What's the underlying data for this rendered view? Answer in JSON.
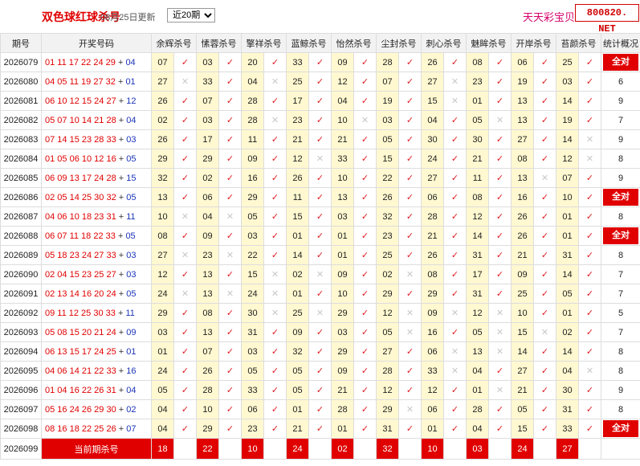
{
  "header": {
    "title": "双色球红球杀号",
    "date": "08月25日更新",
    "period_select": "近20期",
    "brand_name": "天天彩宝贝",
    "brand_domain": "800820. NET"
  },
  "columns": [
    "期号",
    "开奖号码",
    "余辉杀号",
    "愫蓉杀号",
    "擎祥杀号",
    "蓝鲸杀号",
    "怡然杀号",
    "尘封杀号",
    "刺心杀号",
    "魅眸杀号",
    "开岸杀号",
    "苔颜杀号",
    "统计概况"
  ],
  "rows": [
    {
      "issue": "2026079",
      "reds": "01 11 17 22 24 29",
      "blue": "04",
      "kills": [
        [
          "07",
          true
        ],
        [
          "03",
          true
        ],
        [
          "20",
          true
        ],
        [
          "33",
          true
        ],
        [
          "09",
          true
        ],
        [
          "28",
          true
        ],
        [
          "26",
          true
        ],
        [
          "08",
          true
        ],
        [
          "06",
          true
        ],
        [
          "25",
          true
        ]
      ],
      "stat": "全对"
    },
    {
      "issue": "2026080",
      "reds": "04 05 11 19 27 32",
      "blue": "01",
      "kills": [
        [
          "27",
          false
        ],
        [
          "33",
          true
        ],
        [
          "04",
          false
        ],
        [
          "25",
          true
        ],
        [
          "12",
          true
        ],
        [
          "07",
          true
        ],
        [
          "27",
          false
        ],
        [
          "23",
          true
        ],
        [
          "19",
          true
        ],
        [
          "03",
          true
        ]
      ],
      "stat": "6"
    },
    {
      "issue": "2026081",
      "reds": "06 10 12 15 24 27",
      "blue": "12",
      "kills": [
        [
          "26",
          true
        ],
        [
          "07",
          true
        ],
        [
          "28",
          true
        ],
        [
          "17",
          true
        ],
        [
          "04",
          true
        ],
        [
          "19",
          true
        ],
        [
          "15",
          false
        ],
        [
          "01",
          true
        ],
        [
          "13",
          true
        ],
        [
          "14",
          true
        ]
      ],
      "stat": "9"
    },
    {
      "issue": "2026082",
      "reds": "05 07 10 14 21 28",
      "blue": "04",
      "kills": [
        [
          "02",
          true
        ],
        [
          "03",
          true
        ],
        [
          "28",
          false
        ],
        [
          "23",
          true
        ],
        [
          "10",
          false
        ],
        [
          "03",
          true
        ],
        [
          "04",
          true
        ],
        [
          "05",
          false
        ],
        [
          "13",
          true
        ],
        [
          "19",
          true
        ]
      ],
      "stat": "7"
    },
    {
      "issue": "2026083",
      "reds": "07 14 15 23 28 33",
      "blue": "03",
      "kills": [
        [
          "26",
          true
        ],
        [
          "17",
          true
        ],
        [
          "11",
          true
        ],
        [
          "21",
          true
        ],
        [
          "21",
          true
        ],
        [
          "05",
          true
        ],
        [
          "30",
          true
        ],
        [
          "30",
          true
        ],
        [
          "27",
          true
        ],
        [
          "14",
          false
        ]
      ],
      "stat": "9"
    },
    {
      "issue": "2026084",
      "reds": "01 05 06 10 12 16",
      "blue": "05",
      "kills": [
        [
          "29",
          true
        ],
        [
          "29",
          true
        ],
        [
          "09",
          true
        ],
        [
          "12",
          false
        ],
        [
          "33",
          true
        ],
        [
          "15",
          true
        ],
        [
          "24",
          true
        ],
        [
          "21",
          true
        ],
        [
          "08",
          true
        ],
        [
          "12",
          false
        ]
      ],
      "stat": "8"
    },
    {
      "issue": "2026085",
      "reds": "06 09 13 17 24 28",
      "blue": "15",
      "kills": [
        [
          "32",
          true
        ],
        [
          "02",
          true
        ],
        [
          "16",
          true
        ],
        [
          "26",
          true
        ],
        [
          "10",
          true
        ],
        [
          "22",
          true
        ],
        [
          "27",
          true
        ],
        [
          "11",
          true
        ],
        [
          "13",
          false
        ],
        [
          "07",
          true
        ]
      ],
      "stat": "9"
    },
    {
      "issue": "2026086",
      "reds": "02 05 14 25 30 32",
      "blue": "05",
      "kills": [
        [
          "13",
          true
        ],
        [
          "06",
          true
        ],
        [
          "29",
          true
        ],
        [
          "11",
          true
        ],
        [
          "13",
          true
        ],
        [
          "26",
          true
        ],
        [
          "06",
          true
        ],
        [
          "08",
          true
        ],
        [
          "16",
          true
        ],
        [
          "10",
          true
        ]
      ],
      "stat": "全对"
    },
    {
      "issue": "2026087",
      "reds": "04 06 10 18 23 31",
      "blue": "11",
      "kills": [
        [
          "10",
          false
        ],
        [
          "04",
          false
        ],
        [
          "05",
          true
        ],
        [
          "15",
          true
        ],
        [
          "03",
          true
        ],
        [
          "32",
          true
        ],
        [
          "28",
          true
        ],
        [
          "12",
          true
        ],
        [
          "26",
          true
        ],
        [
          "01",
          true
        ]
      ],
      "stat": "8"
    },
    {
      "issue": "2026088",
      "reds": "06 07 11 18 22 33",
      "blue": "05",
      "kills": [
        [
          "08",
          true
        ],
        [
          "09",
          true
        ],
        [
          "03",
          true
        ],
        [
          "01",
          true
        ],
        [
          "01",
          true
        ],
        [
          "23",
          true
        ],
        [
          "21",
          true
        ],
        [
          "14",
          true
        ],
        [
          "26",
          true
        ],
        [
          "01",
          true
        ]
      ],
      "stat": "全对"
    },
    {
      "issue": "2026089",
      "reds": "05 18 23 24 27 33",
      "blue": "03",
      "kills": [
        [
          "27",
          false
        ],
        [
          "23",
          false
        ],
        [
          "22",
          true
        ],
        [
          "14",
          true
        ],
        [
          "01",
          true
        ],
        [
          "25",
          true
        ],
        [
          "26",
          true
        ],
        [
          "31",
          true
        ],
        [
          "21",
          true
        ],
        [
          "31",
          true
        ]
      ],
      "stat": "8"
    },
    {
      "issue": "2026090",
      "reds": "02 04 15 23 25 27",
      "blue": "03",
      "kills": [
        [
          "12",
          true
        ],
        [
          "13",
          true
        ],
        [
          "15",
          false
        ],
        [
          "02",
          false
        ],
        [
          "09",
          true
        ],
        [
          "02",
          false
        ],
        [
          "08",
          true
        ],
        [
          "17",
          true
        ],
        [
          "09",
          true
        ],
        [
          "14",
          true
        ]
      ],
      "stat": "7"
    },
    {
      "issue": "2026091",
      "reds": "02 13 14 16 20 24",
      "blue": "05",
      "kills": [
        [
          "24",
          false
        ],
        [
          "13",
          false
        ],
        [
          "24",
          false
        ],
        [
          "01",
          true
        ],
        [
          "10",
          true
        ],
        [
          "29",
          true
        ],
        [
          "29",
          true
        ],
        [
          "31",
          true
        ],
        [
          "25",
          true
        ],
        [
          "05",
          true
        ]
      ],
      "stat": "7"
    },
    {
      "issue": "2026092",
      "reds": "09 11 12 25 30 33",
      "blue": "11",
      "kills": [
        [
          "29",
          true
        ],
        [
          "08",
          true
        ],
        [
          "30",
          false
        ],
        [
          "25",
          false
        ],
        [
          "29",
          true
        ],
        [
          "12",
          false
        ],
        [
          "09",
          false
        ],
        [
          "12",
          false
        ],
        [
          "10",
          true
        ],
        [
          "01",
          true
        ]
      ],
      "stat": "5"
    },
    {
      "issue": "2026093",
      "reds": "05 08 15 20 21 24",
      "blue": "09",
      "kills": [
        [
          "03",
          true
        ],
        [
          "13",
          true
        ],
        [
          "31",
          true
        ],
        [
          "09",
          true
        ],
        [
          "03",
          true
        ],
        [
          "05",
          false
        ],
        [
          "16",
          true
        ],
        [
          "05",
          false
        ],
        [
          "15",
          false
        ],
        [
          "02",
          true
        ]
      ],
      "stat": "7"
    },
    {
      "issue": "2026094",
      "reds": "06 13 15 17 24 25",
      "blue": "01",
      "kills": [
        [
          "01",
          true
        ],
        [
          "07",
          true
        ],
        [
          "03",
          true
        ],
        [
          "32",
          true
        ],
        [
          "29",
          true
        ],
        [
          "27",
          true
        ],
        [
          "06",
          false
        ],
        [
          "13",
          false
        ],
        [
          "14",
          true
        ],
        [
          "14",
          true
        ]
      ],
      "stat": "8"
    },
    {
      "issue": "2026095",
      "reds": "04 06 14 21 22 33",
      "blue": "16",
      "kills": [
        [
          "24",
          true
        ],
        [
          "26",
          true
        ],
        [
          "05",
          true
        ],
        [
          "05",
          true
        ],
        [
          "09",
          true
        ],
        [
          "28",
          true
        ],
        [
          "33",
          false
        ],
        [
          "04",
          true
        ],
        [
          "27",
          true
        ],
        [
          "04",
          false
        ]
      ],
      "stat": "8"
    },
    {
      "issue": "2026096",
      "reds": "01 04 16 22 26 31",
      "blue": "04",
      "kills": [
        [
          "05",
          true
        ],
        [
          "28",
          true
        ],
        [
          "33",
          true
        ],
        [
          "05",
          true
        ],
        [
          "21",
          true
        ],
        [
          "12",
          true
        ],
        [
          "12",
          true
        ],
        [
          "01",
          false
        ],
        [
          "21",
          true
        ],
        [
          "30",
          true
        ]
      ],
      "stat": "9"
    },
    {
      "issue": "2026097",
      "reds": "05 16 24 26 29 30",
      "blue": "02",
      "kills": [
        [
          "04",
          true
        ],
        [
          "10",
          true
        ],
        [
          "06",
          true
        ],
        [
          "01",
          true
        ],
        [
          "28",
          true
        ],
        [
          "29",
          false
        ],
        [
          "06",
          true
        ],
        [
          "28",
          true
        ],
        [
          "05",
          true
        ],
        [
          "31",
          true
        ]
      ],
      "stat": "8"
    },
    {
      "issue": "2026098",
      "reds": "08 16 18 22 25 26",
      "blue": "07",
      "kills": [
        [
          "04",
          true
        ],
        [
          "29",
          true
        ],
        [
          "23",
          true
        ],
        [
          "21",
          true
        ],
        [
          "01",
          true
        ],
        [
          "31",
          true
        ],
        [
          "01",
          true
        ],
        [
          "04",
          true
        ],
        [
          "15",
          true
        ],
        [
          "33",
          true
        ]
      ],
      "stat": "全对"
    }
  ],
  "current": {
    "issue": "2026099",
    "label": "当前期杀号",
    "kills": [
      "18",
      "22",
      "10",
      "24",
      "02",
      "32",
      "10",
      "03",
      "24",
      "27"
    ]
  },
  "icons": {
    "correct": "check-mark-icon",
    "wrong": "cross-mark-icon"
  },
  "colors": {
    "accent_red": "#e00000",
    "blue_ball": "#1a33b8",
    "kill_number_bg": "#fff8d0",
    "header_bg": "#f2f2f2",
    "brand_pink": "#d6006a"
  }
}
